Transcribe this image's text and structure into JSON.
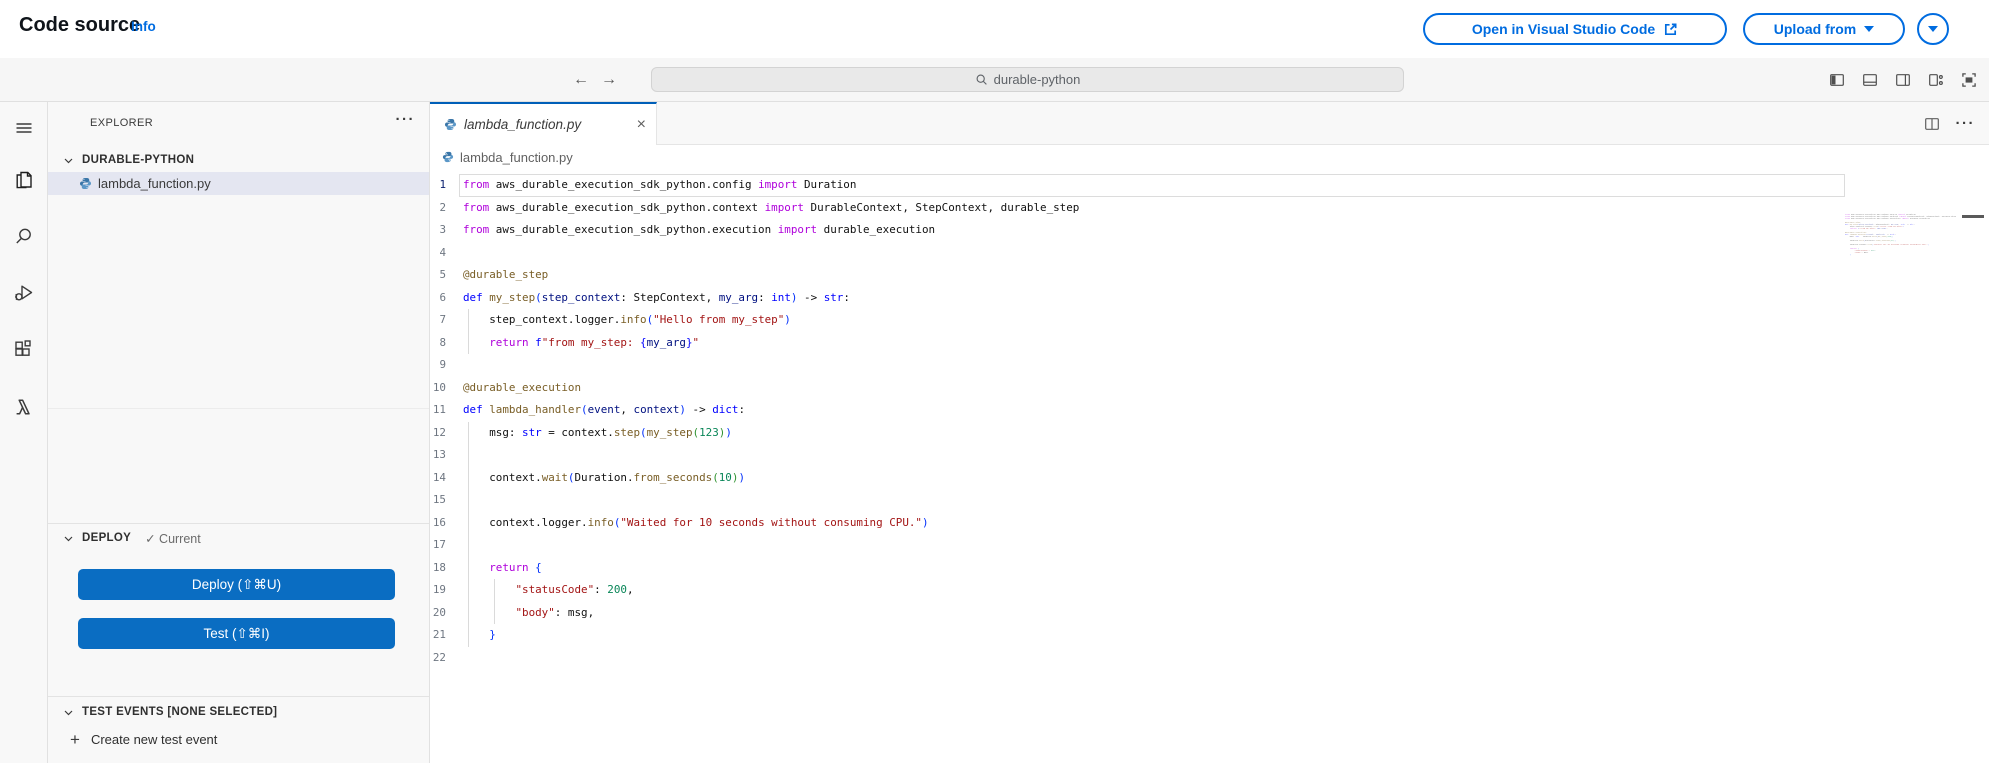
{
  "header": {
    "title": "Code source",
    "info": "Info",
    "open_vscode": "Open in Visual Studio Code",
    "upload_from": "Upload from"
  },
  "titlebar": {
    "search": "durable-python"
  },
  "sidebar": {
    "explorer": "EXPLORER",
    "folder": "DURABLE-PYTHON",
    "file": "lambda_function.py",
    "deploy_label": "DEPLOY",
    "deploy_status": "✓ Current",
    "deploy_button": "Deploy (⇧⌘U)",
    "test_button": "Test (⇧⌘I)",
    "test_events_label": "TEST EVENTS [NONE SELECTED]",
    "create_test_event": "Create new test event"
  },
  "editor": {
    "tab": "lambda_function.py",
    "breadcrumb": "lambda_function.py",
    "code_lines": [
      {
        "n": 1,
        "indent": 0,
        "cur": true,
        "seg": [
          [
            "kw",
            "from"
          ],
          [
            "pl",
            " aws_durable_execution_sdk_python.config "
          ],
          [
            "kw",
            "import"
          ],
          [
            "pl",
            " Duration"
          ]
        ]
      },
      {
        "n": 2,
        "indent": 0,
        "seg": [
          [
            "kw",
            "from"
          ],
          [
            "pl",
            " aws_durable_execution_sdk_python.context "
          ],
          [
            "kw",
            "import"
          ],
          [
            "pl",
            " DurableContext, StepContext, durable_step"
          ]
        ]
      },
      {
        "n": 3,
        "indent": 0,
        "seg": [
          [
            "kw",
            "from"
          ],
          [
            "pl",
            " aws_durable_execution_sdk_python.execution "
          ],
          [
            "kw",
            "import"
          ],
          [
            "pl",
            " durable_execution"
          ]
        ]
      },
      {
        "n": 4,
        "indent": 0,
        "seg": []
      },
      {
        "n": 5,
        "indent": 0,
        "seg": [
          [
            "fn",
            "@durable_step"
          ]
        ]
      },
      {
        "n": 6,
        "indent": 0,
        "seg": [
          [
            "kw2",
            "def "
          ],
          [
            "fn",
            "my_step"
          ],
          [
            "p1",
            "("
          ],
          [
            "var",
            "step_context"
          ],
          [
            "pl",
            ": StepContext, "
          ],
          [
            "var",
            "my_arg"
          ],
          [
            "pl",
            ": "
          ],
          [
            "kw2",
            "int"
          ],
          [
            "p1",
            ")"
          ],
          [
            "pl",
            " -> "
          ],
          [
            "kw2",
            "str"
          ],
          [
            "pl",
            ":"
          ]
        ]
      },
      {
        "n": 7,
        "indent": 4,
        "seg": [
          [
            "pl",
            "step_context.logger."
          ],
          [
            "fn",
            "info"
          ],
          [
            "p1",
            "("
          ],
          [
            "str",
            "\"Hello from my_step\""
          ],
          [
            "p1",
            ")"
          ]
        ]
      },
      {
        "n": 8,
        "indent": 4,
        "seg": [
          [
            "kw",
            "return "
          ],
          [
            "kw2",
            "f"
          ],
          [
            "str",
            "\"from my_step: "
          ],
          [
            "kw2",
            "{"
          ],
          [
            "var",
            "my_arg"
          ],
          [
            "kw2",
            "}"
          ],
          [
            "str",
            "\""
          ]
        ]
      },
      {
        "n": 9,
        "indent": 0,
        "seg": []
      },
      {
        "n": 10,
        "indent": 0,
        "seg": [
          [
            "fn",
            "@durable_execution"
          ]
        ]
      },
      {
        "n": 11,
        "indent": 0,
        "seg": [
          [
            "kw2",
            "def "
          ],
          [
            "fn",
            "lambda_handler"
          ],
          [
            "p1",
            "("
          ],
          [
            "var",
            "event"
          ],
          [
            "pl",
            ", "
          ],
          [
            "var",
            "context"
          ],
          [
            "p1",
            ")"
          ],
          [
            "pl",
            " -> "
          ],
          [
            "kw2",
            "dict"
          ],
          [
            "pl",
            ":"
          ]
        ]
      },
      {
        "n": 12,
        "indent": 4,
        "seg": [
          [
            "pl",
            "msg: "
          ],
          [
            "kw2",
            "str"
          ],
          [
            "pl",
            " = context."
          ],
          [
            "fn",
            "step"
          ],
          [
            "p1",
            "("
          ],
          [
            "fn",
            "my_step"
          ],
          [
            "p2",
            "("
          ],
          [
            "num",
            "123"
          ],
          [
            "p2",
            ")"
          ],
          [
            "p1",
            ")"
          ]
        ]
      },
      {
        "n": 13,
        "indent": 4,
        "seg": []
      },
      {
        "n": 14,
        "indent": 4,
        "seg": [
          [
            "pl",
            "context."
          ],
          [
            "fn",
            "wait"
          ],
          [
            "p1",
            "("
          ],
          [
            "pl",
            "Duration."
          ],
          [
            "fn",
            "from_seconds"
          ],
          [
            "p2",
            "("
          ],
          [
            "num",
            "10"
          ],
          [
            "p2",
            ")"
          ],
          [
            "p1",
            ")"
          ]
        ]
      },
      {
        "n": 15,
        "indent": 4,
        "seg": []
      },
      {
        "n": 16,
        "indent": 4,
        "seg": [
          [
            "pl",
            "context.logger."
          ],
          [
            "fn",
            "info"
          ],
          [
            "p1",
            "("
          ],
          [
            "str",
            "\"Waited for 10 seconds without consuming CPU.\""
          ],
          [
            "p1",
            ")"
          ]
        ]
      },
      {
        "n": 17,
        "indent": 4,
        "seg": []
      },
      {
        "n": 18,
        "indent": 4,
        "seg": [
          [
            "kw",
            "return "
          ],
          [
            "p1",
            "{"
          ]
        ]
      },
      {
        "n": 19,
        "indent": 8,
        "seg": [
          [
            "str",
            "\"statusCode\""
          ],
          [
            "pl",
            ": "
          ],
          [
            "num",
            "200"
          ],
          [
            "pl",
            ","
          ]
        ]
      },
      {
        "n": 20,
        "indent": 8,
        "seg": [
          [
            "str",
            "\"body\""
          ],
          [
            "pl",
            ": msg,"
          ]
        ]
      },
      {
        "n": 21,
        "indent": 4,
        "seg": [
          [
            "p1",
            "}"
          ]
        ]
      },
      {
        "n": 22,
        "indent": 0,
        "seg": []
      }
    ]
  },
  "colors": {
    "aws_accent": "#006ce0",
    "deploy_button_blue": "#0a6dc2",
    "tab_active_border": "#005fb8",
    "file_selected_bg": "#e4e6f1",
    "keyword_magenta": "#af00db",
    "keyword_blue": "#0000ff",
    "function_brown": "#795e26",
    "string_red": "#a31515",
    "number_green": "#098658"
  }
}
